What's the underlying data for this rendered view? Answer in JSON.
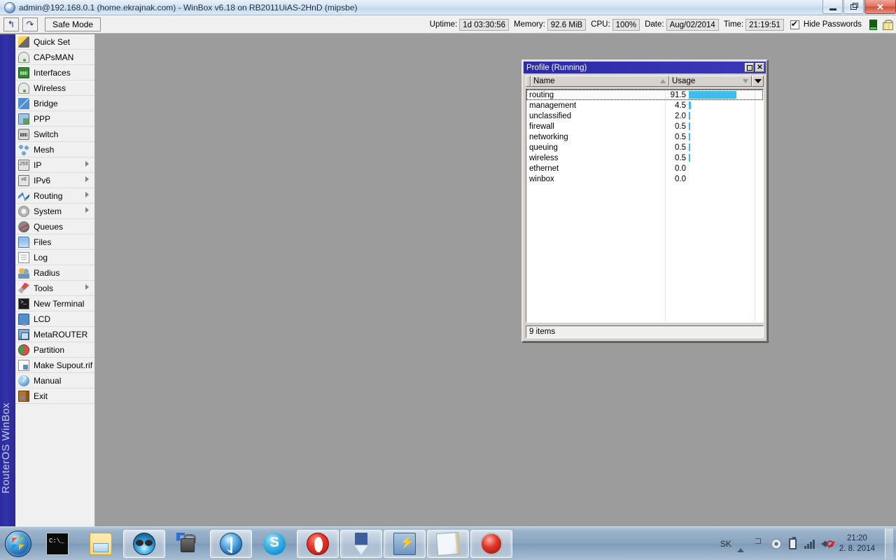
{
  "window": {
    "title": "admin@192.168.0.1 (home.ekrajnak.com) - WinBox v6.18 on RB2011UiAS-2HnD (mipsbe)",
    "icon": "winbox-globe-icon",
    "buttons": {
      "minimize": "minimize-button",
      "restore": "restore-button",
      "close": "close-button"
    }
  },
  "toolbar": {
    "undo_label": "↰",
    "redo_label": "↷",
    "safe_mode_label": "Safe Mode",
    "status": {
      "uptime_label": "Uptime:",
      "uptime_value": "1d 03:30:56",
      "memory_label": "Memory:",
      "memory_value": "92.6 MiB",
      "cpu_label": "CPU:",
      "cpu_value": "100%",
      "date_label": "Date:",
      "date_value": "Aug/02/2014",
      "time_label": "Time:",
      "time_value": "21:19:51",
      "hide_passwords_label": "Hide Passwords",
      "hide_passwords_checked": true
    }
  },
  "sidebar": {
    "brand": "RouterOS WinBox",
    "items": [
      {
        "label": "Quick Set",
        "icon": "quickset-icon",
        "submenu": false
      },
      {
        "label": "CAPsMAN",
        "icon": "capsman-icon",
        "submenu": false
      },
      {
        "label": "Interfaces",
        "icon": "interfaces-icon",
        "submenu": false
      },
      {
        "label": "Wireless",
        "icon": "wireless-icon",
        "submenu": false
      },
      {
        "label": "Bridge",
        "icon": "bridge-icon",
        "submenu": false
      },
      {
        "label": "PPP",
        "icon": "ppp-icon",
        "submenu": false
      },
      {
        "label": "Switch",
        "icon": "switch-icon",
        "submenu": false
      },
      {
        "label": "Mesh",
        "icon": "mesh-icon",
        "submenu": false
      },
      {
        "label": "IP",
        "icon": "ip-icon",
        "submenu": true
      },
      {
        "label": "IPv6",
        "icon": "ipv6-icon",
        "submenu": true
      },
      {
        "label": "Routing",
        "icon": "routing-icon",
        "submenu": true
      },
      {
        "label": "System",
        "icon": "system-icon",
        "submenu": true
      },
      {
        "label": "Queues",
        "icon": "queues-icon",
        "submenu": false
      },
      {
        "label": "Files",
        "icon": "files-icon",
        "submenu": false
      },
      {
        "label": "Log",
        "icon": "log-icon",
        "submenu": false
      },
      {
        "label": "Radius",
        "icon": "radius-icon",
        "submenu": false
      },
      {
        "label": "Tools",
        "icon": "tools-icon",
        "submenu": true
      },
      {
        "label": "New Terminal",
        "icon": "terminal-icon",
        "submenu": false
      },
      {
        "label": "LCD",
        "icon": "lcd-icon",
        "submenu": false
      },
      {
        "label": "MetaROUTER",
        "icon": "metarouter-icon",
        "submenu": false
      },
      {
        "label": "Partition",
        "icon": "partition-icon",
        "submenu": false
      },
      {
        "label": "Make Supout.rif",
        "icon": "supout-icon",
        "submenu": false
      },
      {
        "label": "Manual",
        "icon": "manual-icon",
        "submenu": false
      },
      {
        "label": "Exit",
        "icon": "exit-icon",
        "submenu": false
      }
    ]
  },
  "profile_window": {
    "title": "Profile (Running)",
    "maximize_label": "□",
    "close_label": "✕",
    "columns": [
      {
        "label": "Name",
        "sort": "asc"
      },
      {
        "label": "Usage",
        "sort": "desc"
      }
    ],
    "dropdown_label": "▼",
    "status_text": "9 items",
    "bar_color": "#3fbdef",
    "rows": [
      {
        "name": "routing",
        "usage": "91.5",
        "usage_num": 91.5,
        "selected": true
      },
      {
        "name": "management",
        "usage": "4.5",
        "usage_num": 4.5,
        "selected": false
      },
      {
        "name": "unclassified",
        "usage": "2.0",
        "usage_num": 2.0,
        "selected": false
      },
      {
        "name": "firewall",
        "usage": "0.5",
        "usage_num": 0.5,
        "selected": false
      },
      {
        "name": "networking",
        "usage": "0.5",
        "usage_num": 0.5,
        "selected": false
      },
      {
        "name": "queuing",
        "usage": "0.5",
        "usage_num": 0.5,
        "selected": false
      },
      {
        "name": "wireless",
        "usage": "0.5",
        "usage_num": 0.5,
        "selected": false
      },
      {
        "name": "ethernet",
        "usage": "0.0",
        "usage_num": 0.0,
        "selected": false
      },
      {
        "name": "winbox",
        "usage": "0.0",
        "usage_num": 0.0,
        "selected": false
      }
    ]
  },
  "taskbar": {
    "start_label": "start-orb",
    "items": [
      {
        "icon": "command-prompt-icon",
        "active": false
      },
      {
        "icon": "file-explorer-icon",
        "active": false
      },
      {
        "icon": "winbox-icon",
        "active": true
      },
      {
        "icon": "lock-shield-icon",
        "active": false
      },
      {
        "icon": "java-icon",
        "active": true
      },
      {
        "icon": "skype-icon",
        "active": false
      },
      {
        "icon": "opera-icon",
        "active": true
      },
      {
        "icon": "download-icon",
        "active": true
      },
      {
        "icon": "network-config-icon",
        "active": true
      },
      {
        "icon": "notepad-icon",
        "active": true
      },
      {
        "icon": "red-orb-icon",
        "active": true
      }
    ],
    "tray": {
      "language": "SK",
      "icons": [
        "show-hidden-icons-icon",
        "action-center-flag-icon",
        "media-icon",
        "battery-icon",
        "network-signal-icon",
        "volume-muted-icon"
      ],
      "clock_time": "21:20",
      "clock_date": "2. 8. 2014"
    }
  }
}
